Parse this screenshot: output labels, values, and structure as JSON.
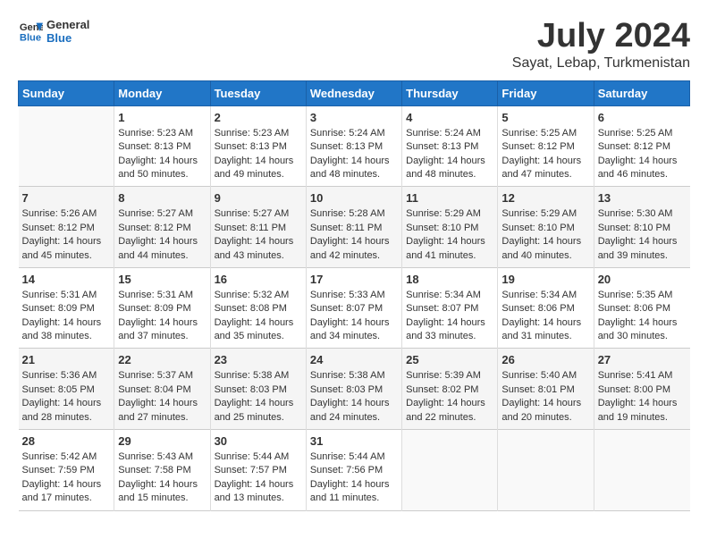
{
  "logo": {
    "line1": "General",
    "line2": "Blue"
  },
  "title": "July 2024",
  "subtitle": "Sayat, Lebap, Turkmenistan",
  "weekdays": [
    "Sunday",
    "Monday",
    "Tuesday",
    "Wednesday",
    "Thursday",
    "Friday",
    "Saturday"
  ],
  "weeks": [
    [
      {
        "day": "",
        "info": ""
      },
      {
        "day": "1",
        "info": "Sunrise: 5:23 AM\nSunset: 8:13 PM\nDaylight: 14 hours and 50 minutes."
      },
      {
        "day": "2",
        "info": "Sunrise: 5:23 AM\nSunset: 8:13 PM\nDaylight: 14 hours and 49 minutes."
      },
      {
        "day": "3",
        "info": "Sunrise: 5:24 AM\nSunset: 8:13 PM\nDaylight: 14 hours and 48 minutes."
      },
      {
        "day": "4",
        "info": "Sunrise: 5:24 AM\nSunset: 8:13 PM\nDaylight: 14 hours and 48 minutes."
      },
      {
        "day": "5",
        "info": "Sunrise: 5:25 AM\nSunset: 8:12 PM\nDaylight: 14 hours and 47 minutes."
      },
      {
        "day": "6",
        "info": "Sunrise: 5:25 AM\nSunset: 8:12 PM\nDaylight: 14 hours and 46 minutes."
      }
    ],
    [
      {
        "day": "7",
        "info": "Sunrise: 5:26 AM\nSunset: 8:12 PM\nDaylight: 14 hours and 45 minutes."
      },
      {
        "day": "8",
        "info": "Sunrise: 5:27 AM\nSunset: 8:12 PM\nDaylight: 14 hours and 44 minutes."
      },
      {
        "day": "9",
        "info": "Sunrise: 5:27 AM\nSunset: 8:11 PM\nDaylight: 14 hours and 43 minutes."
      },
      {
        "day": "10",
        "info": "Sunrise: 5:28 AM\nSunset: 8:11 PM\nDaylight: 14 hours and 42 minutes."
      },
      {
        "day": "11",
        "info": "Sunrise: 5:29 AM\nSunset: 8:10 PM\nDaylight: 14 hours and 41 minutes."
      },
      {
        "day": "12",
        "info": "Sunrise: 5:29 AM\nSunset: 8:10 PM\nDaylight: 14 hours and 40 minutes."
      },
      {
        "day": "13",
        "info": "Sunrise: 5:30 AM\nSunset: 8:10 PM\nDaylight: 14 hours and 39 minutes."
      }
    ],
    [
      {
        "day": "14",
        "info": "Sunrise: 5:31 AM\nSunset: 8:09 PM\nDaylight: 14 hours and 38 minutes."
      },
      {
        "day": "15",
        "info": "Sunrise: 5:31 AM\nSunset: 8:09 PM\nDaylight: 14 hours and 37 minutes."
      },
      {
        "day": "16",
        "info": "Sunrise: 5:32 AM\nSunset: 8:08 PM\nDaylight: 14 hours and 35 minutes."
      },
      {
        "day": "17",
        "info": "Sunrise: 5:33 AM\nSunset: 8:07 PM\nDaylight: 14 hours and 34 minutes."
      },
      {
        "day": "18",
        "info": "Sunrise: 5:34 AM\nSunset: 8:07 PM\nDaylight: 14 hours and 33 minutes."
      },
      {
        "day": "19",
        "info": "Sunrise: 5:34 AM\nSunset: 8:06 PM\nDaylight: 14 hours and 31 minutes."
      },
      {
        "day": "20",
        "info": "Sunrise: 5:35 AM\nSunset: 8:06 PM\nDaylight: 14 hours and 30 minutes."
      }
    ],
    [
      {
        "day": "21",
        "info": "Sunrise: 5:36 AM\nSunset: 8:05 PM\nDaylight: 14 hours and 28 minutes."
      },
      {
        "day": "22",
        "info": "Sunrise: 5:37 AM\nSunset: 8:04 PM\nDaylight: 14 hours and 27 minutes."
      },
      {
        "day": "23",
        "info": "Sunrise: 5:38 AM\nSunset: 8:03 PM\nDaylight: 14 hours and 25 minutes."
      },
      {
        "day": "24",
        "info": "Sunrise: 5:38 AM\nSunset: 8:03 PM\nDaylight: 14 hours and 24 minutes."
      },
      {
        "day": "25",
        "info": "Sunrise: 5:39 AM\nSunset: 8:02 PM\nDaylight: 14 hours and 22 minutes."
      },
      {
        "day": "26",
        "info": "Sunrise: 5:40 AM\nSunset: 8:01 PM\nDaylight: 14 hours and 20 minutes."
      },
      {
        "day": "27",
        "info": "Sunrise: 5:41 AM\nSunset: 8:00 PM\nDaylight: 14 hours and 19 minutes."
      }
    ],
    [
      {
        "day": "28",
        "info": "Sunrise: 5:42 AM\nSunset: 7:59 PM\nDaylight: 14 hours and 17 minutes."
      },
      {
        "day": "29",
        "info": "Sunrise: 5:43 AM\nSunset: 7:58 PM\nDaylight: 14 hours and 15 minutes."
      },
      {
        "day": "30",
        "info": "Sunrise: 5:44 AM\nSunset: 7:57 PM\nDaylight: 14 hours and 13 minutes."
      },
      {
        "day": "31",
        "info": "Sunrise: 5:44 AM\nSunset: 7:56 PM\nDaylight: 14 hours and 11 minutes."
      },
      {
        "day": "",
        "info": ""
      },
      {
        "day": "",
        "info": ""
      },
      {
        "day": "",
        "info": ""
      }
    ]
  ]
}
